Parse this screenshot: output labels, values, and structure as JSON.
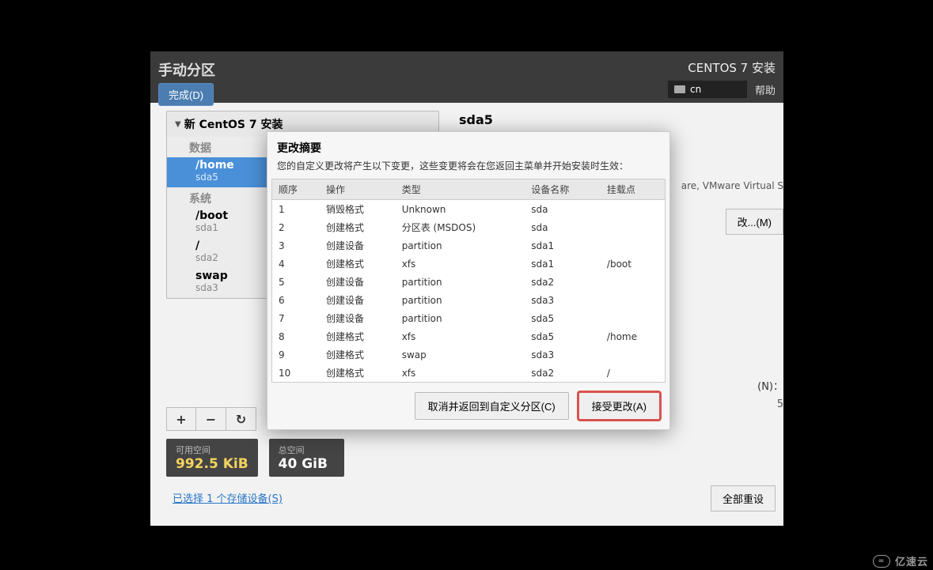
{
  "header": {
    "page_title": "手动分区",
    "done_btn": "完成(D)",
    "install_label": "CENTOS 7 安装",
    "keyboard": "cn",
    "help_btn": "帮助"
  },
  "left_panel": {
    "tree_header": "新 CentOS 7 安装",
    "section_data": "数据",
    "section_system": "系统",
    "items": [
      {
        "path": "/home",
        "dev": "sda5",
        "selected": true
      },
      {
        "path": "/boot",
        "dev": "sda1"
      },
      {
        "path": "/",
        "dev": "sda2"
      },
      {
        "path": "swap",
        "dev": "sda3"
      }
    ]
  },
  "toolbar": {
    "add": "+",
    "remove": "−",
    "reload_icon": "↻"
  },
  "right": {
    "title": "sda5",
    "device_text": "are, VMware Virtual S",
    "modify_btn": "改...(M)",
    "name_label": "(N)：",
    "name_val": "5"
  },
  "space": {
    "avail_label": "可用空间",
    "avail_val": "992.5 KiB",
    "total_label": "总空间",
    "total_val": "40 GiB"
  },
  "devices_link": "已选择 1 个存储设备(S)",
  "reset_btn": "全部重设",
  "dialog": {
    "title": "更改摘要",
    "desc": "您的自定义更改将产生以下变更，这些变更将会在您返回主菜单并开始安装时生效：",
    "headers": {
      "order": "顺序",
      "op": "操作",
      "type": "类型",
      "device": "设备名称",
      "mount": "挂载点"
    },
    "rows": [
      {
        "order": "1",
        "op": "销毁格式",
        "op_cls": "destroy",
        "type": "Unknown",
        "device": "sda",
        "mount": ""
      },
      {
        "order": "2",
        "op": "创建格式",
        "op_cls": "create",
        "type": "分区表 (MSDOS)",
        "device": "sda",
        "mount": ""
      },
      {
        "order": "3",
        "op": "创建设备",
        "op_cls": "create",
        "type": "partition",
        "device": "sda1",
        "mount": ""
      },
      {
        "order": "4",
        "op": "创建格式",
        "op_cls": "create",
        "type": "xfs",
        "device": "sda1",
        "mount": "/boot"
      },
      {
        "order": "5",
        "op": "创建设备",
        "op_cls": "create",
        "type": "partition",
        "device": "sda2",
        "mount": ""
      },
      {
        "order": "6",
        "op": "创建设备",
        "op_cls": "create",
        "type": "partition",
        "device": "sda3",
        "mount": ""
      },
      {
        "order": "7",
        "op": "创建设备",
        "op_cls": "create",
        "type": "partition",
        "device": "sda5",
        "mount": ""
      },
      {
        "order": "8",
        "op": "创建格式",
        "op_cls": "create",
        "type": "xfs",
        "device": "sda5",
        "mount": "/home"
      },
      {
        "order": "9",
        "op": "创建格式",
        "op_cls": "create",
        "type": "swap",
        "device": "sda3",
        "mount": ""
      },
      {
        "order": "10",
        "op": "创建格式",
        "op_cls": "create",
        "type": "xfs",
        "device": "sda2",
        "mount": "/"
      }
    ],
    "cancel_btn": "取消并返回到自定义分区(C)",
    "accept_btn": "接受更改(A)"
  },
  "watermark": "亿速云"
}
